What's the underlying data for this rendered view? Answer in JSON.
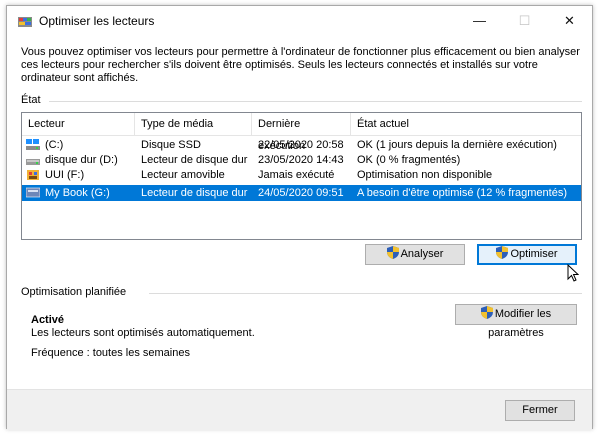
{
  "window": {
    "title": "Optimiser les lecteurs",
    "minimize_glyph": "—",
    "maximize_glyph": "☐",
    "close_glyph": "✕"
  },
  "description": "Vous pouvez optimiser vos lecteurs pour permettre à l'ordinateur de fonctionner plus efficacement ou bien analyser ces lecteurs pour rechercher s'ils doivent être optimisés. Seuls les lecteurs connectés et installés sur votre ordinateur sont affichés.",
  "status_group": {
    "label": "État"
  },
  "drives_table": {
    "columns": [
      "Lecteur",
      "Type de média",
      "Dernière exécution",
      "État actuel"
    ],
    "rows": [
      {
        "icon": "ssd-drive-icon",
        "drive": "(C:)",
        "media": "Disque SSD",
        "last_run": "22/05/2020 20:58",
        "status": "OK (1 jours depuis la dernière exécution)",
        "selected": false
      },
      {
        "icon": "hard-drive-icon",
        "drive": "disque dur (D:)",
        "media": "Lecteur de disque dur",
        "last_run": "23/05/2020 14:43",
        "status": "OK (0 % fragmentés)",
        "selected": false
      },
      {
        "icon": "removable-drive-icon",
        "drive": "UUI (F:)",
        "media": "Lecteur amovible",
        "last_run": "Jamais exécuté",
        "status": "Optimisation non disponible",
        "selected": false
      },
      {
        "icon": "external-drive-icon",
        "drive": "My Book (G:)",
        "media": "Lecteur de disque dur",
        "last_run": "24/05/2020 09:51",
        "status": "A besoin d'être optimisé (12 % fragmentés)",
        "selected": true
      }
    ]
  },
  "actions": {
    "analyze_label": "Analyser",
    "optimize_label": "Optimiser"
  },
  "scheduled": {
    "group_label": "Optimisation planifiée",
    "state": "Activé",
    "description": "Les lecteurs sont optimisés automatiquement.",
    "frequency": "Fréquence : toutes les semaines",
    "change_settings_label": "Modifier les paramètres"
  },
  "footer": {
    "close_label": "Fermer"
  },
  "colors": {
    "selection": "#0078d7",
    "button_face": "#e1e1e1",
    "footer_bg": "#f0f0f0"
  }
}
